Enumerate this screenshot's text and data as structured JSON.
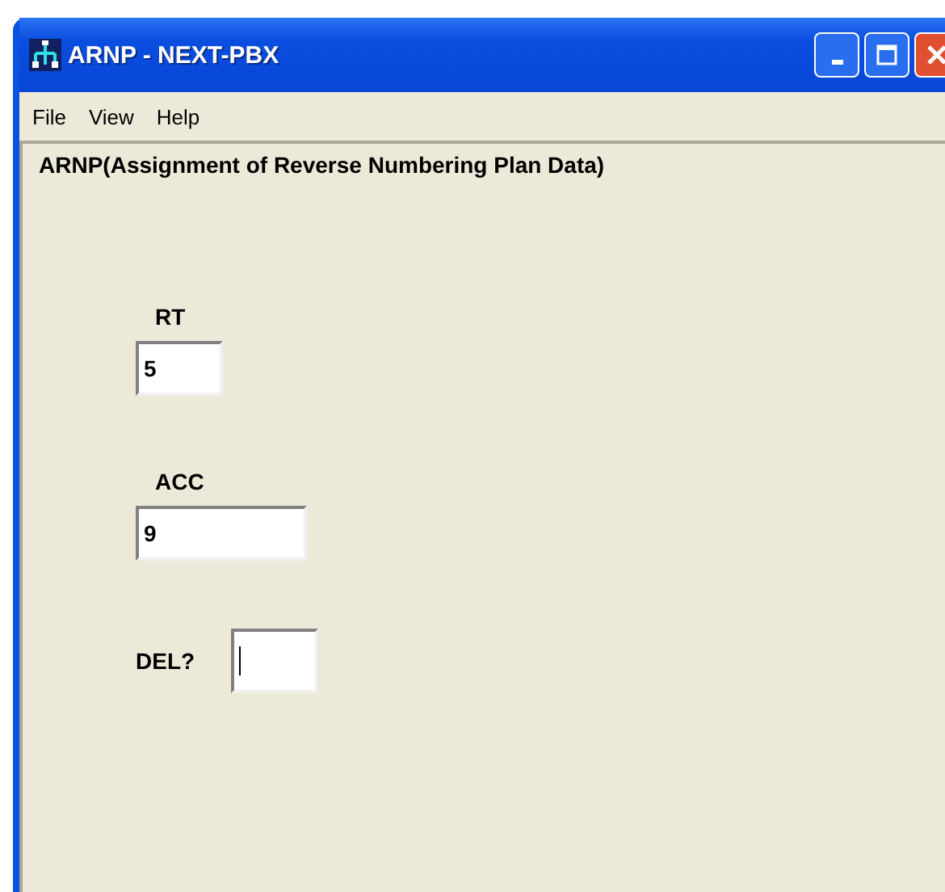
{
  "window": {
    "title": "ARNP - NEXT-PBX"
  },
  "menu": [
    "File",
    "View",
    "Help"
  ],
  "heading": "ARNP(Assignment of Reverse Numbering Plan Data)",
  "fields": [
    {
      "label": "RT",
      "value": "5",
      "kind": "short",
      "focused": false
    },
    {
      "label": "ACC",
      "value": "9",
      "kind": "long",
      "focused": false
    },
    {
      "label": "DEL?",
      "kind": "inline",
      "focused": true
    }
  ]
}
